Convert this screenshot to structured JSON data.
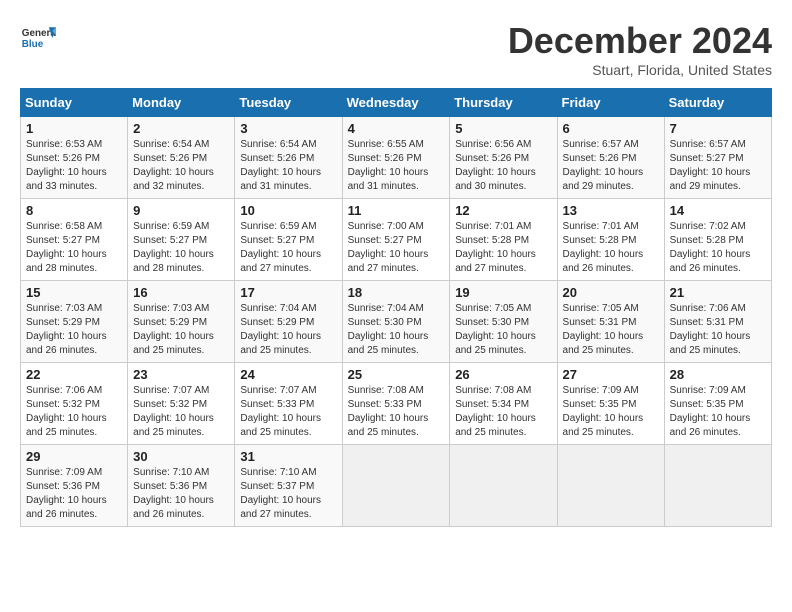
{
  "header": {
    "logo_line1": "General",
    "logo_line2": "Blue",
    "month": "December 2024",
    "location": "Stuart, Florida, United States"
  },
  "weekdays": [
    "Sunday",
    "Monday",
    "Tuesday",
    "Wednesday",
    "Thursday",
    "Friday",
    "Saturday"
  ],
  "weeks": [
    [
      {
        "day": "1",
        "info": "Sunrise: 6:53 AM\nSunset: 5:26 PM\nDaylight: 10 hours\nand 33 minutes."
      },
      {
        "day": "2",
        "info": "Sunrise: 6:54 AM\nSunset: 5:26 PM\nDaylight: 10 hours\nand 32 minutes."
      },
      {
        "day": "3",
        "info": "Sunrise: 6:54 AM\nSunset: 5:26 PM\nDaylight: 10 hours\nand 31 minutes."
      },
      {
        "day": "4",
        "info": "Sunrise: 6:55 AM\nSunset: 5:26 PM\nDaylight: 10 hours\nand 31 minutes."
      },
      {
        "day": "5",
        "info": "Sunrise: 6:56 AM\nSunset: 5:26 PM\nDaylight: 10 hours\nand 30 minutes."
      },
      {
        "day": "6",
        "info": "Sunrise: 6:57 AM\nSunset: 5:26 PM\nDaylight: 10 hours\nand 29 minutes."
      },
      {
        "day": "7",
        "info": "Sunrise: 6:57 AM\nSunset: 5:27 PM\nDaylight: 10 hours\nand 29 minutes."
      }
    ],
    [
      {
        "day": "8",
        "info": "Sunrise: 6:58 AM\nSunset: 5:27 PM\nDaylight: 10 hours\nand 28 minutes."
      },
      {
        "day": "9",
        "info": "Sunrise: 6:59 AM\nSunset: 5:27 PM\nDaylight: 10 hours\nand 28 minutes."
      },
      {
        "day": "10",
        "info": "Sunrise: 6:59 AM\nSunset: 5:27 PM\nDaylight: 10 hours\nand 27 minutes."
      },
      {
        "day": "11",
        "info": "Sunrise: 7:00 AM\nSunset: 5:27 PM\nDaylight: 10 hours\nand 27 minutes."
      },
      {
        "day": "12",
        "info": "Sunrise: 7:01 AM\nSunset: 5:28 PM\nDaylight: 10 hours\nand 27 minutes."
      },
      {
        "day": "13",
        "info": "Sunrise: 7:01 AM\nSunset: 5:28 PM\nDaylight: 10 hours\nand 26 minutes."
      },
      {
        "day": "14",
        "info": "Sunrise: 7:02 AM\nSunset: 5:28 PM\nDaylight: 10 hours\nand 26 minutes."
      }
    ],
    [
      {
        "day": "15",
        "info": "Sunrise: 7:03 AM\nSunset: 5:29 PM\nDaylight: 10 hours\nand 26 minutes."
      },
      {
        "day": "16",
        "info": "Sunrise: 7:03 AM\nSunset: 5:29 PM\nDaylight: 10 hours\nand 25 minutes."
      },
      {
        "day": "17",
        "info": "Sunrise: 7:04 AM\nSunset: 5:29 PM\nDaylight: 10 hours\nand 25 minutes."
      },
      {
        "day": "18",
        "info": "Sunrise: 7:04 AM\nSunset: 5:30 PM\nDaylight: 10 hours\nand 25 minutes."
      },
      {
        "day": "19",
        "info": "Sunrise: 7:05 AM\nSunset: 5:30 PM\nDaylight: 10 hours\nand 25 minutes."
      },
      {
        "day": "20",
        "info": "Sunrise: 7:05 AM\nSunset: 5:31 PM\nDaylight: 10 hours\nand 25 minutes."
      },
      {
        "day": "21",
        "info": "Sunrise: 7:06 AM\nSunset: 5:31 PM\nDaylight: 10 hours\nand 25 minutes."
      }
    ],
    [
      {
        "day": "22",
        "info": "Sunrise: 7:06 AM\nSunset: 5:32 PM\nDaylight: 10 hours\nand 25 minutes."
      },
      {
        "day": "23",
        "info": "Sunrise: 7:07 AM\nSunset: 5:32 PM\nDaylight: 10 hours\nand 25 minutes."
      },
      {
        "day": "24",
        "info": "Sunrise: 7:07 AM\nSunset: 5:33 PM\nDaylight: 10 hours\nand 25 minutes."
      },
      {
        "day": "25",
        "info": "Sunrise: 7:08 AM\nSunset: 5:33 PM\nDaylight: 10 hours\nand 25 minutes."
      },
      {
        "day": "26",
        "info": "Sunrise: 7:08 AM\nSunset: 5:34 PM\nDaylight: 10 hours\nand 25 minutes."
      },
      {
        "day": "27",
        "info": "Sunrise: 7:09 AM\nSunset: 5:35 PM\nDaylight: 10 hours\nand 25 minutes."
      },
      {
        "day": "28",
        "info": "Sunrise: 7:09 AM\nSunset: 5:35 PM\nDaylight: 10 hours\nand 26 minutes."
      }
    ],
    [
      {
        "day": "29",
        "info": "Sunrise: 7:09 AM\nSunset: 5:36 PM\nDaylight: 10 hours\nand 26 minutes."
      },
      {
        "day": "30",
        "info": "Sunrise: 7:10 AM\nSunset: 5:36 PM\nDaylight: 10 hours\nand 26 minutes."
      },
      {
        "day": "31",
        "info": "Sunrise: 7:10 AM\nSunset: 5:37 PM\nDaylight: 10 hours\nand 27 minutes."
      },
      {
        "day": "",
        "info": ""
      },
      {
        "day": "",
        "info": ""
      },
      {
        "day": "",
        "info": ""
      },
      {
        "day": "",
        "info": ""
      }
    ]
  ]
}
